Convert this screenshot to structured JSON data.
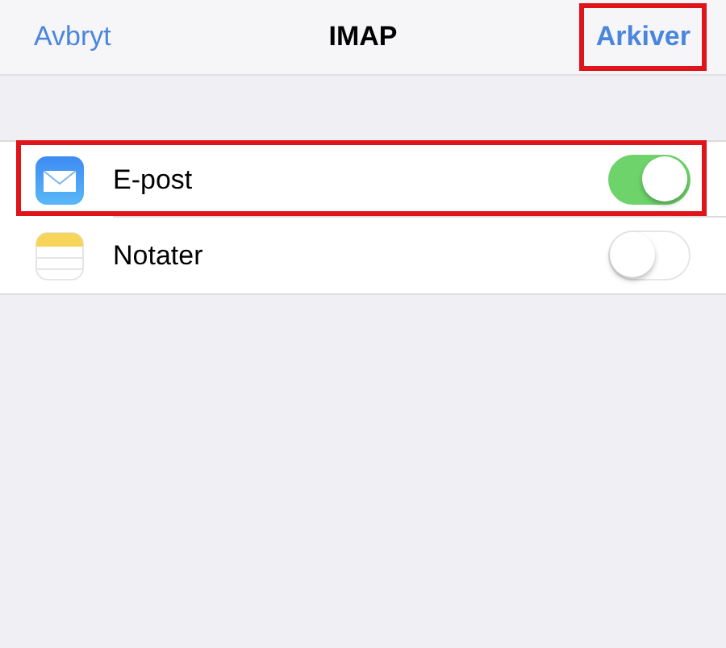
{
  "nav_bar": {
    "cancel": {
      "label": "Avbryt",
      "highlighted": false
    },
    "title": "IMAP",
    "save": {
      "label": "Arkiver",
      "highlighted": true
    }
  },
  "rows": [
    {
      "kind": "mail",
      "label": "E-post",
      "on": true,
      "highlighted": true
    },
    {
      "kind": "notes",
      "label": "Notater",
      "on": false,
      "highlighted": false
    }
  ]
}
